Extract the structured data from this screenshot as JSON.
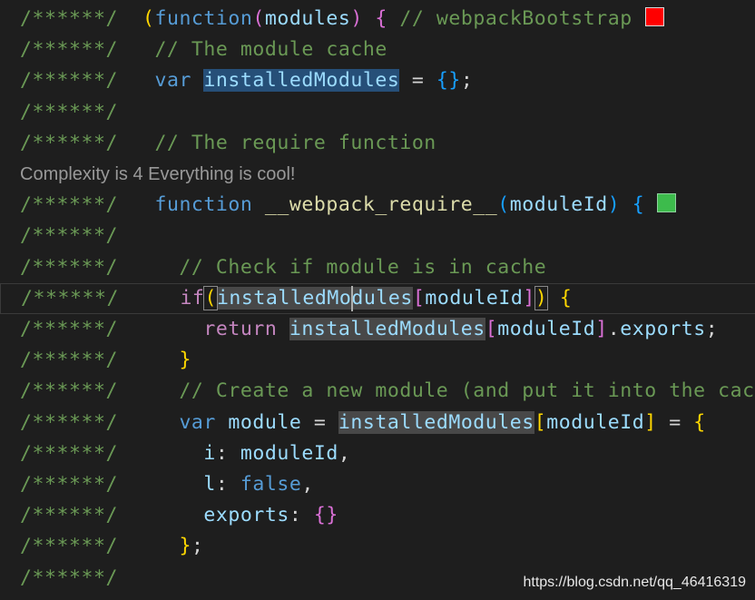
{
  "editor": {
    "colors": {
      "background": "#1e1e1e",
      "comment": "#6a9955",
      "keyword": "#569cd6",
      "control": "#c586c0",
      "function": "#dcdcaa",
      "variable": "#9cdcfe",
      "plain": "#d4d4d4",
      "bracket_gold": "#ffd700",
      "bracket_purple": "#da70d6",
      "bracket_blue": "#179fff",
      "selection": "#264f78",
      "highlight": "#484848",
      "marker_red": "#ff0000",
      "marker_green": "#3dbb4c",
      "lens": "#999999"
    },
    "code_lens": "Complexity is 4 Everything is cool!",
    "watermark": "https://blog.csdn.net/qq_46416319",
    "lines": [
      {
        "tokens": [
          {
            "t": "/******/ ",
            "c": "comment"
          },
          {
            "t": " ",
            "c": "plain"
          },
          {
            "t": "(",
            "c": "bracket_gold"
          },
          {
            "t": "function",
            "c": "keyword"
          },
          {
            "t": "(",
            "c": "bracket_purple"
          },
          {
            "t": "modules",
            "c": "variable"
          },
          {
            "t": ")",
            "c": "bracket_purple"
          },
          {
            "t": " ",
            "c": "plain"
          },
          {
            "t": "{",
            "c": "bracket_purple"
          },
          {
            "t": " // webpackBootstrap",
            "c": "comment"
          }
        ],
        "marker": "red"
      },
      {
        "tokens": [
          {
            "t": "/******/ ",
            "c": "comment"
          },
          {
            "t": "  // The module cache",
            "c": "comment"
          }
        ]
      },
      {
        "tokens": [
          {
            "t": "/******/ ",
            "c": "comment"
          },
          {
            "t": "  ",
            "c": "plain"
          },
          {
            "t": "var",
            "c": "keyword"
          },
          {
            "t": " ",
            "c": "plain"
          },
          {
            "t": "installedModules",
            "c": "variable",
            "h": "sel"
          },
          {
            "t": " = ",
            "c": "plain"
          },
          {
            "t": "{}",
            "c": "bracket_blue"
          },
          {
            "t": ";",
            "c": "plain"
          }
        ]
      },
      {
        "tokens": [
          {
            "t": "/******/",
            "c": "comment"
          }
        ]
      },
      {
        "tokens": [
          {
            "t": "/******/ ",
            "c": "comment"
          },
          {
            "t": "  // The require function",
            "c": "comment"
          }
        ]
      },
      {
        "lens": true
      },
      {
        "tokens": [
          {
            "t": "/******/ ",
            "c": "comment"
          },
          {
            "t": "  ",
            "c": "plain"
          },
          {
            "t": "function",
            "c": "keyword"
          },
          {
            "t": " ",
            "c": "plain"
          },
          {
            "t": "__webpack_require__",
            "c": "function"
          },
          {
            "t": "(",
            "c": "bracket_blue"
          },
          {
            "t": "moduleId",
            "c": "variable"
          },
          {
            "t": ")",
            "c": "bracket_blue"
          },
          {
            "t": " ",
            "c": "plain"
          },
          {
            "t": "{",
            "c": "bracket_blue"
          }
        ],
        "marker": "green"
      },
      {
        "tokens": [
          {
            "t": "/******/",
            "c": "comment"
          }
        ]
      },
      {
        "tokens": [
          {
            "t": "/******/ ",
            "c": "comment"
          },
          {
            "t": "    // Check if module is in cache",
            "c": "comment"
          }
        ]
      },
      {
        "current": true,
        "tokens": [
          {
            "t": "/******/ ",
            "c": "comment"
          },
          {
            "t": "    ",
            "c": "plain"
          },
          {
            "t": "if",
            "c": "control"
          },
          {
            "t": "(",
            "c": "bracket_gold",
            "box": true
          },
          {
            "t": "installedMo",
            "c": "variable",
            "h": "ref"
          },
          {
            "t": "",
            "c": "plain",
            "caret": true
          },
          {
            "t": "dules",
            "c": "variable",
            "h": "ref"
          },
          {
            "t": "[",
            "c": "bracket_purple"
          },
          {
            "t": "moduleId",
            "c": "variable"
          },
          {
            "t": "]",
            "c": "bracket_purple"
          },
          {
            "t": ")",
            "c": "bracket_gold",
            "box": true
          },
          {
            "t": " ",
            "c": "plain"
          },
          {
            "t": "{",
            "c": "bracket_gold"
          }
        ]
      },
      {
        "tokens": [
          {
            "t": "/******/ ",
            "c": "comment"
          },
          {
            "t": "      ",
            "c": "plain"
          },
          {
            "t": "return",
            "c": "control"
          },
          {
            "t": " ",
            "c": "plain"
          },
          {
            "t": "installedModules",
            "c": "variable",
            "h": "ref"
          },
          {
            "t": "[",
            "c": "bracket_purple"
          },
          {
            "t": "moduleId",
            "c": "variable"
          },
          {
            "t": "]",
            "c": "bracket_purple"
          },
          {
            "t": ".",
            "c": "plain"
          },
          {
            "t": "exports",
            "c": "variable"
          },
          {
            "t": ";",
            "c": "plain"
          }
        ]
      },
      {
        "tokens": [
          {
            "t": "/******/ ",
            "c": "comment"
          },
          {
            "t": "    ",
            "c": "plain"
          },
          {
            "t": "}",
            "c": "bracket_gold"
          }
        ]
      },
      {
        "tokens": [
          {
            "t": "/******/ ",
            "c": "comment"
          },
          {
            "t": "    // Create a new module (and put it into the cac",
            "c": "comment"
          }
        ]
      },
      {
        "tokens": [
          {
            "t": "/******/ ",
            "c": "comment"
          },
          {
            "t": "    ",
            "c": "plain"
          },
          {
            "t": "var",
            "c": "keyword"
          },
          {
            "t": " ",
            "c": "plain"
          },
          {
            "t": "module",
            "c": "variable"
          },
          {
            "t": " = ",
            "c": "plain"
          },
          {
            "t": "installedModules",
            "c": "variable",
            "h": "ref"
          },
          {
            "t": "[",
            "c": "bracket_gold"
          },
          {
            "t": "moduleId",
            "c": "variable"
          },
          {
            "t": "]",
            "c": "bracket_gold"
          },
          {
            "t": " = ",
            "c": "plain"
          },
          {
            "t": "{",
            "c": "bracket_gold"
          }
        ]
      },
      {
        "tokens": [
          {
            "t": "/******/ ",
            "c": "comment"
          },
          {
            "t": "      ",
            "c": "plain"
          },
          {
            "t": "i",
            "c": "variable"
          },
          {
            "t": ": ",
            "c": "plain"
          },
          {
            "t": "moduleId",
            "c": "variable"
          },
          {
            "t": ",",
            "c": "plain"
          }
        ]
      },
      {
        "tokens": [
          {
            "t": "/******/ ",
            "c": "comment"
          },
          {
            "t": "      ",
            "c": "plain"
          },
          {
            "t": "l",
            "c": "variable"
          },
          {
            "t": ": ",
            "c": "plain"
          },
          {
            "t": "false",
            "c": "keyword"
          },
          {
            "t": ",",
            "c": "plain"
          }
        ]
      },
      {
        "tokens": [
          {
            "t": "/******/ ",
            "c": "comment"
          },
          {
            "t": "      ",
            "c": "plain"
          },
          {
            "t": "exports",
            "c": "variable"
          },
          {
            "t": ": ",
            "c": "plain"
          },
          {
            "t": "{}",
            "c": "bracket_purple"
          }
        ]
      },
      {
        "tokens": [
          {
            "t": "/******/ ",
            "c": "comment"
          },
          {
            "t": "    ",
            "c": "plain"
          },
          {
            "t": "}",
            "c": "bracket_gold"
          },
          {
            "t": ";",
            "c": "plain"
          }
        ]
      },
      {
        "tokens": [
          {
            "t": "/******/",
            "c": "comment"
          }
        ]
      }
    ]
  }
}
